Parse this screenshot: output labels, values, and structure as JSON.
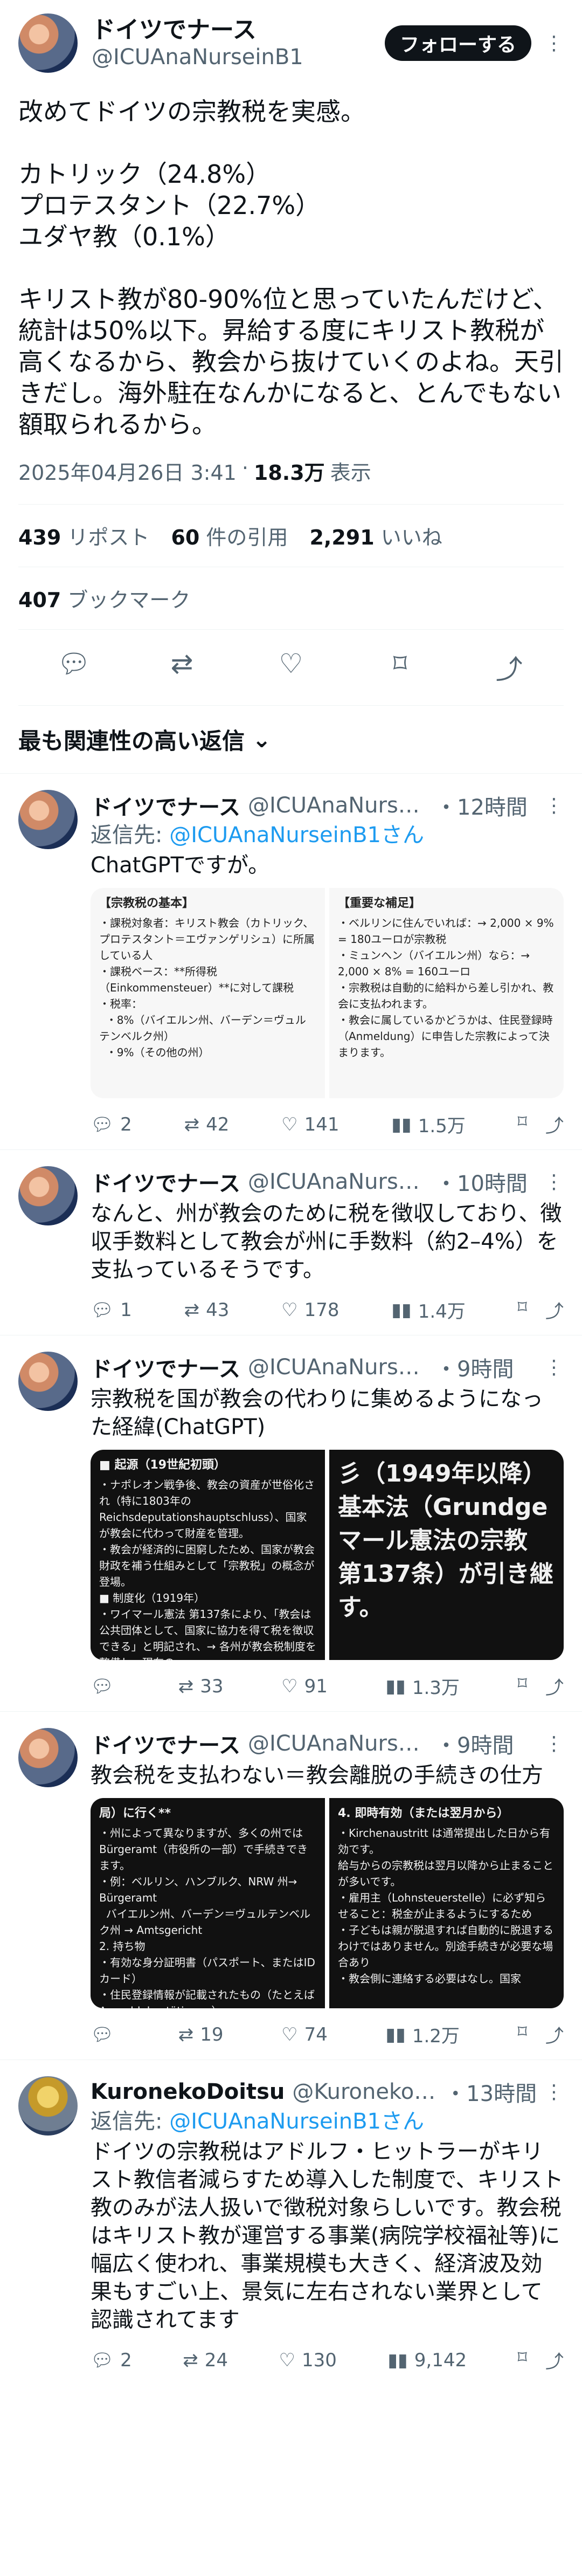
{
  "main": {
    "display_name": "ドイツでナース",
    "handle": "@ICUAnaNurseinB1",
    "follow_label": "フォローする",
    "text": "改めてドイツの宗教税を実感。\n\nカトリック（24.8%）\nプロテスタント（22.7%）\nユダヤ教（0.1%）\n\nキリスト教が80-90%位と思っていたんだけど、統計は50%以下。昇給する度にキリスト教税が高くなるから、教会から抜けていくのよね。天引きだし。海外駐在なんかになると、とんでもない額取られるから。",
    "timestamp": "2025年04月26日 3:41",
    "views_count": "18.3万",
    "views_label": "表示",
    "reposts_count": "439",
    "reposts_label": "リポスト",
    "quotes_count": "60",
    "quotes_label": "件の引用",
    "likes_count": "2,291",
    "likes_label": "いいね",
    "bookmarks_count": "407",
    "bookmarks_label": "ブックマーク"
  },
  "sort_label": "最も関連性の高い返信",
  "replies": [
    {
      "name": "ドイツでナース",
      "handle": "@ICUAnaNursei...",
      "time": "・12時間",
      "replying_prefix": "返信先:",
      "replying_to": "@ICUAnaNurseinB1さん",
      "text": "ChatGPTですが。",
      "media_left_title": "【宗教税の基本】",
      "media_left_text": "・課税対象者：キリスト教会（カトリック、プロテスタント＝エヴァンゲリシュ）に所属している人\n・課税ベース：**所得税（Einkommensteuer）**に対して課税\n・税率：\n  ・8%（バイエルン州、バーデン＝ヴュルテンベルク州）\n  ・9%（その他の州）",
      "media_right_title": "【重要な補足】",
      "media_right_text": "・ベルリンに住んでいれば：→ 2,000 × 9% = 180ユーロが宗教税\n・ミュンヘン（バイエルン州）なら：→ 2,000 × 8% = 160ユーロ\n・宗教税は自動的に給料から差し引かれ、教会に支払われます。\n・教会に属しているかどうかは、住民登録時（Anmeldung）に申告した宗教によって決まります。",
      "replies": "2",
      "reposts": "42",
      "likes": "141",
      "views": "1.5万"
    },
    {
      "name": "ドイツでナース",
      "handle": "@ICUAnaNursei...",
      "time": "・10時間",
      "text": "なんと、州が教会のために税を徴収しており、徴収手数料として教会が州に手数料（約2–4%）を支払っているそうです。",
      "replies": "1",
      "reposts": "43",
      "likes": "178",
      "views": "1.4万"
    },
    {
      "name": "ドイツでナース",
      "handle": "@ICUAnaNursein...",
      "time": "・9時間",
      "text": "宗教税を国が教会の代わりに集めるようになった経緯(ChatGPT)",
      "media_left_title": "■ 起源（19世紀初頭）",
      "media_left_text": "・ナポレオン戦争後、教会の資産が世俗化され（特に1803年のReichsdeputationshauptschluss）、国家が教会に代わって財産を管理。\n・教会が経済的に困窮したため、国家が教会財政を補う仕組みとして「宗教税」の概念が登場。\n■ 制度化（1919年）\n・ワイマール憲法 第137条により、「教会は公共団体として、国家に協力を得て税を徴収できる」と明記され、→ 各州が教会税制度を整備し、現在の",
      "media_right_big": "彡（1949年以降）\n基本法（Grundge\nマール憲法の宗教\n第137条）が引き継\nす。",
      "replies": "",
      "reposts": "33",
      "likes": "91",
      "views": "1.3万"
    },
    {
      "name": "ドイツでナース",
      "handle": "@ICUAnaNursein...",
      "time": "・9時間",
      "text": "教会税を支払わない＝教会離脱の手続きの仕方",
      "media_left_title": "局）に行く**",
      "media_left_text": "・州によって異なりますが、多くの州ではBürgeramt（市役所の一部）で手続きできます。\n・例：ベルリン、ハンブルク、NRW 州→ Bürgeramt\n  バイエルン州、バーデン＝ヴュルテンベルク州 → Amtsgericht\n2. 持ち物\n・有効な身分証明書（パスポート、またはIDカード）\n・住民登録情報が記載されたもの（たとえば Anmeldebestätigung）",
      "media_right_title": "4. 即時有効（または翌月から）",
      "media_right_text": "・Kirchenaustritt は通常提出した日から有効です。\n給与からの宗教税は翌月以降から止まることが多いです。\n・雇用主（Lohnsteuerstelle）に必ず知らせること：税金が止まるようにするため\n・子どもは親が脱退すれば自動的に脱退するわけではありません。別途手続きが必要な場合あり\n・教会側に連絡する必要はなし。国家",
      "replies": "",
      "reposts": "19",
      "likes": "74",
      "views": "1.2万"
    },
    {
      "name": "KuronekoDoitsu",
      "handle": "@KuronekoDoi...",
      "time": "・13時間",
      "replying_prefix": "返信先:",
      "replying_to": "@ICUAnaNurseinB1さん",
      "text": "ドイツの宗教税はアドルフ・ヒットラーがキリスト教信者減らすため導入した制度で、キリスト教のみが法人扱いで徴税対象らしいです。教会税はキリスト教が運営する事業(病院学校福祉等)に幅広く使われ、事業規模も大きく、経済波及効果もすごい上、景気に左右されない業界として認識されてます",
      "replies": "2",
      "reposts": "24",
      "likes": "130",
      "views": "9,142"
    }
  ]
}
